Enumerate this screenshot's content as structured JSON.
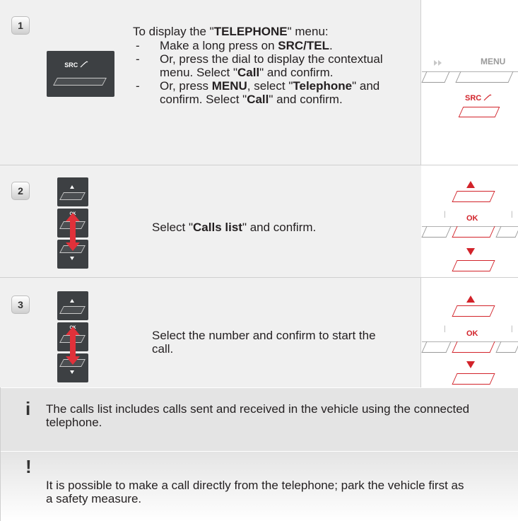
{
  "step1": {
    "number": "1",
    "intro_before": "To display the \"",
    "intro_bold": "TELEPHONE",
    "intro_after": "\" menu:",
    "items": [
      {
        "dash": "-",
        "a": "Make a long press on ",
        "b": "SRC/TEL",
        "c": "."
      },
      {
        "dash": "-",
        "a": "Or, press the dial to display the contextual menu. Select \"",
        "b": "Call",
        "c": "\" and confirm."
      },
      {
        "dash": "-",
        "a": "Or, press ",
        "b": "MENU",
        "c": ", select \"",
        "b2": "Telephone",
        "c2": "\" and confirm. Select \"",
        "b3": "Call",
        "c3": "\" and confirm."
      }
    ],
    "button_label": "SRC",
    "right_menu_label": "MENU",
    "right_src_label": "SRC"
  },
  "step2": {
    "number": "2",
    "text_before": "Select \"",
    "text_bold": "Calls list",
    "text_after": "\" and confirm.",
    "ok_label": "OK",
    "small_ok": "OK"
  },
  "step3": {
    "number": "3",
    "text": "Select the number and confirm to start the call.",
    "ok_label": "OK",
    "small_ok": "OK"
  },
  "info": {
    "icon": "i",
    "text": "The calls list includes calls sent and received in the vehicle using the connected telephone."
  },
  "warning": {
    "icon": "!",
    "text": "It is possible to make a call directly from the telephone; park the vehicle first as a safety measure."
  },
  "icons": {
    "phone": "phone-handset-icon",
    "arrow_up": "arrow-up-icon",
    "arrow_down": "arrow-down-icon",
    "fast_forward": "fast-forward-icon"
  },
  "colors": {
    "accent_red": "#d2232a",
    "button_dark": "#3d4043",
    "row_bg": "#f0f0f0",
    "note_bg": "#e4e4e4"
  }
}
